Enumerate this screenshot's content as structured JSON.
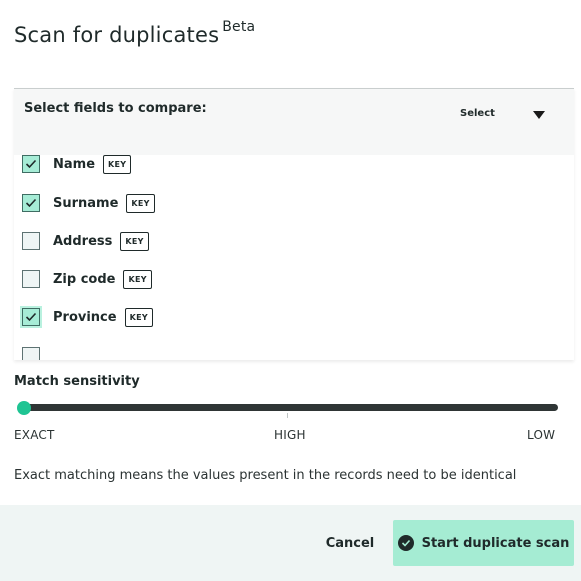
{
  "dialog": {
    "title": "Scan for duplicates",
    "title_badge": "Beta"
  },
  "fields": {
    "label": "Select fields to compare:",
    "select_label": "Select",
    "items": [
      {
        "name": "Name",
        "badge": "KEY",
        "checked": true
      },
      {
        "name": "Surname",
        "badge": "KEY",
        "checked": true
      },
      {
        "name": "Address",
        "badge": "KEY",
        "checked": false
      },
      {
        "name": "Zip code",
        "badge": "KEY",
        "checked": false
      },
      {
        "name": "Province",
        "badge": "KEY",
        "checked": true
      }
    ]
  },
  "sensitivity": {
    "label": "Match sensitivity",
    "value": 0,
    "ticks": [
      "EXACT",
      "HIGH",
      "LOW"
    ],
    "description": "Exact matching means the values present in the records need to be identical"
  },
  "footer": {
    "cancel_label": "Cancel",
    "start_label": "Start duplicate scan"
  },
  "colors": {
    "accent": "#1fc493",
    "checked_fill": "#a6ecd6",
    "footer_bg": "#eff5f4",
    "primary_button": "#a5ecd3"
  }
}
